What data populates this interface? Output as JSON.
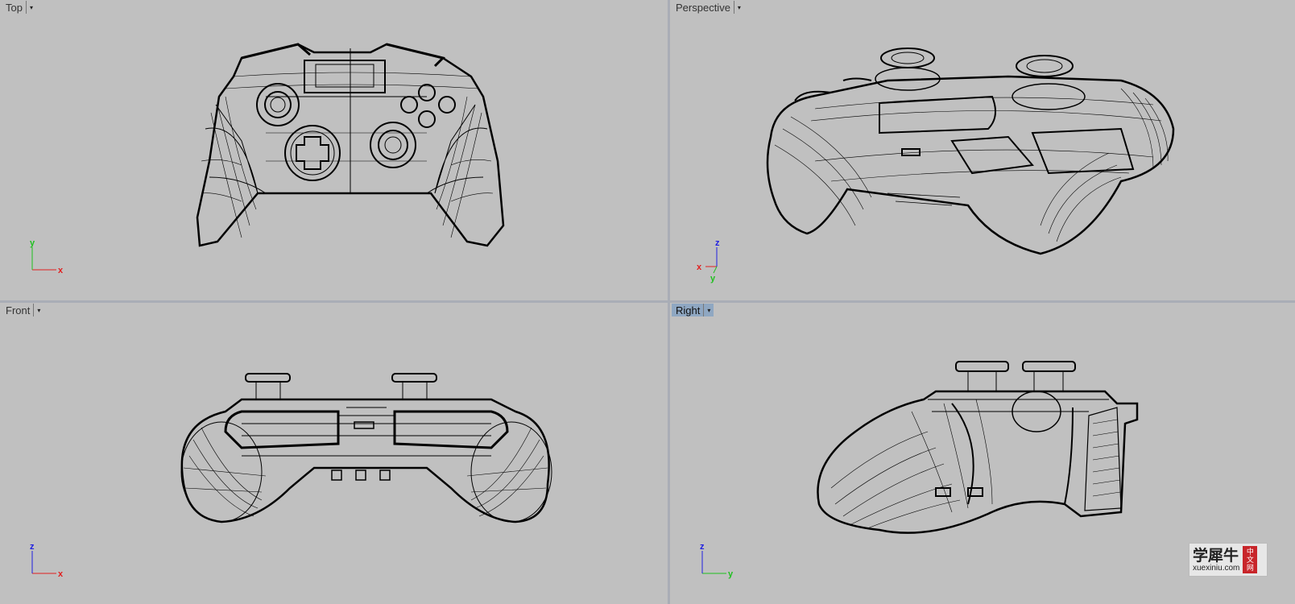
{
  "viewports": {
    "top": {
      "label": "Top",
      "axis_h": "x",
      "axis_v": "y"
    },
    "perspective": {
      "label": "Perspective",
      "axis_h": "x",
      "axis_v": "z",
      "axis_d": "y"
    },
    "front": {
      "label": "Front",
      "axis_h": "x",
      "axis_v": "z"
    },
    "right": {
      "label": "Right",
      "axis_h": "y",
      "axis_v": "z",
      "active": true
    }
  },
  "dropdown_glyph": "▾",
  "watermark": {
    "chinese": "学犀牛",
    "domain": "xuexiniu.com",
    "seal": [
      "中",
      "文",
      "网"
    ]
  },
  "colors": {
    "viewport_bg": "#c0c0c0",
    "active_tab": "#8fa7c2",
    "axis_x": "#e02020",
    "axis_y": "#20c020",
    "axis_z": "#2020e0",
    "wire": "#000000"
  }
}
